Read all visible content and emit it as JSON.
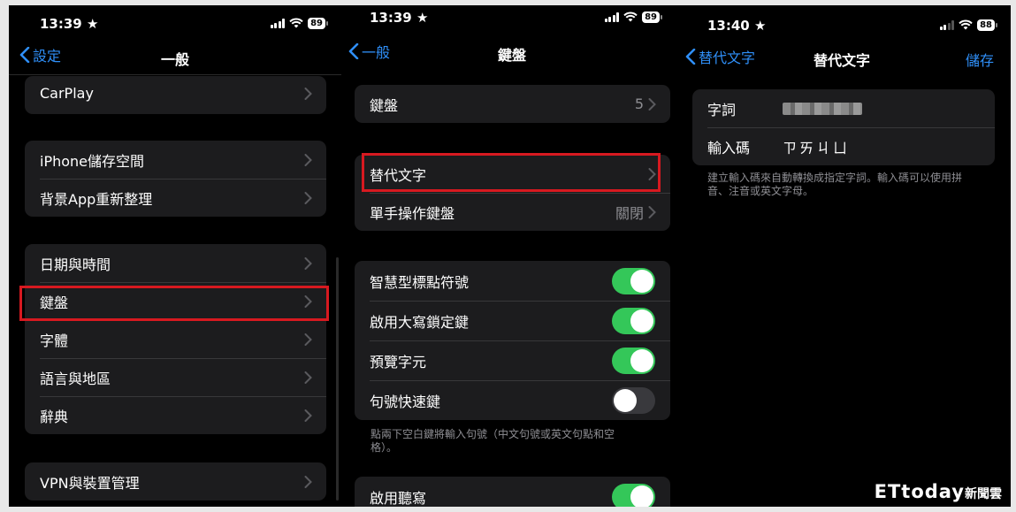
{
  "panel1": {
    "time": "13:39",
    "battery": "89",
    "back_label": "設定",
    "title": "一般",
    "carplay": "CarPlay",
    "group2": [
      "iPhone儲存空間",
      "背景App重新整理"
    ],
    "group3": [
      "日期與時間",
      "鍵盤",
      "字體",
      "語言與地區",
      "辭典"
    ],
    "vpn": "VPN與裝置管理"
  },
  "panel2": {
    "time": "13:39",
    "battery": "89",
    "back_label": "一般",
    "title": "鍵盤",
    "keyboards": {
      "label": "鍵盤",
      "value": "5"
    },
    "text_replacement": "替代文字",
    "one_handed": {
      "label": "單手操作鍵盤",
      "value": "關閉"
    },
    "toggles": [
      {
        "label": "智慧型標點符號",
        "on": true
      },
      {
        "label": "啟用大寫鎖定鍵",
        "on": true
      },
      {
        "label": "預覽字元",
        "on": true
      },
      {
        "label": "句號快速鍵",
        "on": false
      }
    ],
    "footnote": "點兩下空白鍵將輸入句號（中文句號或英文句點和空格）。",
    "dictation": {
      "label": "啟用聽寫",
      "on": true
    }
  },
  "panel3": {
    "time": "13:40",
    "battery": "88",
    "back_label": "替代文字",
    "title": "替代文字",
    "save_label": "儲存",
    "phrase_label": "字詞",
    "shortcut_label": "輸入碼",
    "shortcut_value": "ㄗㄞㄐㄩ",
    "footnote": "建立輸入碼來自動轉換成指定字詞。輸入碼可以使用拼音、注音或英文字母。"
  },
  "watermark": {
    "brand": "ETtoday",
    "suffix": "新聞雲"
  },
  "colors": {
    "accent": "#2f8ff8",
    "toggle_on": "#34c759",
    "highlight": "#d71920",
    "background": "#000000",
    "cell": "#1c1c1e"
  }
}
